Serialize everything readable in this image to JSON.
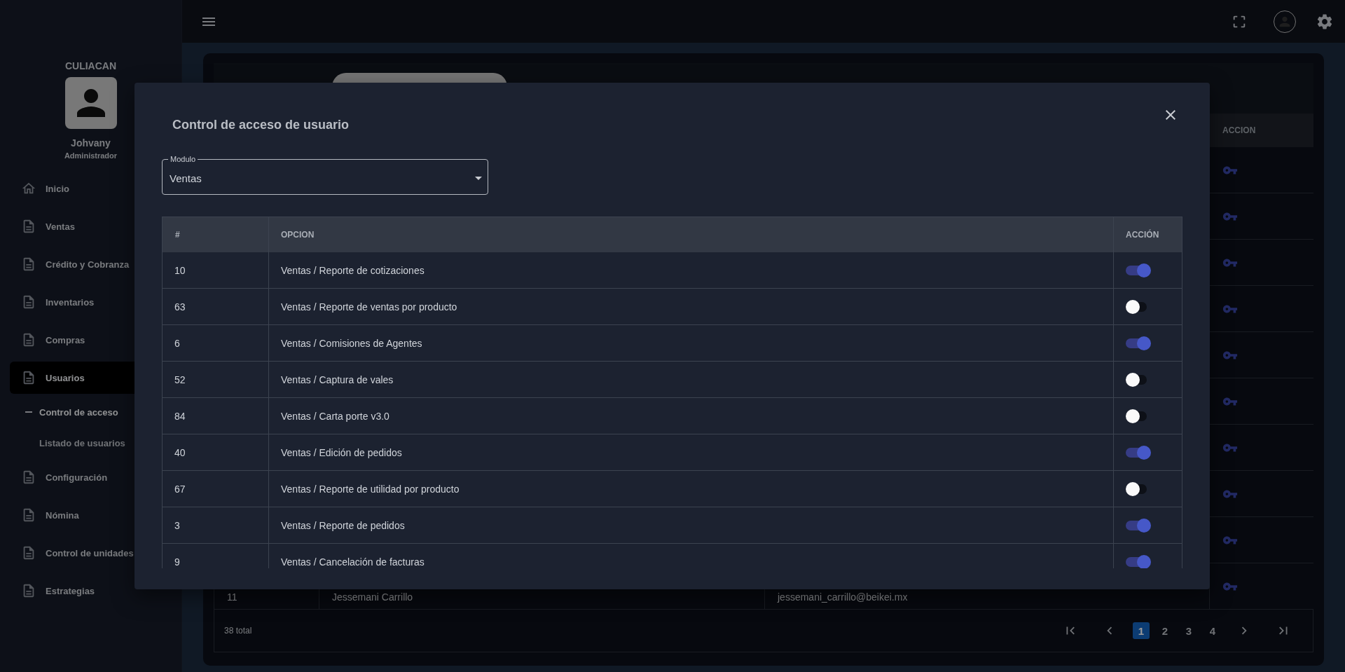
{
  "sidebar": {
    "branch": "CULIACAN",
    "user": {
      "name": "Johvany",
      "role": "Administrador"
    },
    "items": [
      {
        "label": "Inicio",
        "kind": "home",
        "selected": false
      },
      {
        "label": "Ventas",
        "kind": "document",
        "selected": false
      },
      {
        "label": "Crédito y Cobranza",
        "kind": "document",
        "selected": false
      },
      {
        "label": "Inventarios",
        "kind": "document",
        "selected": false
      },
      {
        "label": "Compras",
        "kind": "document",
        "selected": false
      },
      {
        "label": "Usuarios",
        "kind": "document",
        "selected": true,
        "children": [
          {
            "label": "Control de acceso",
            "selected": true
          },
          {
            "label": "Listado de usuarios",
            "selected": false
          }
        ]
      },
      {
        "label": "Configuración",
        "kind": "document",
        "selected": false
      },
      {
        "label": "Nómina",
        "kind": "document",
        "selected": false
      },
      {
        "label": "Control de unidades",
        "kind": "document",
        "selected": false
      },
      {
        "label": "Estrategias",
        "kind": "document",
        "selected": false
      }
    ]
  },
  "users_table": {
    "columns": [
      "ACCION"
    ],
    "rows": [
      {
        "kind": "covered"
      },
      {
        "kind": "covered"
      },
      {
        "kind": "covered"
      },
      {
        "kind": "covered"
      },
      {
        "kind": "covered"
      },
      {
        "kind": "covered"
      },
      {
        "kind": "covered"
      },
      {
        "kind": "covered"
      },
      {
        "kind": "covered"
      },
      {
        "kind": "full",
        "column_1": "11",
        "column_2": "Jessemani Carrillo",
        "column_3": "jessemani_carrillo@beikei.mx"
      }
    ],
    "total": "38 total",
    "pages": [
      {
        "label": "1",
        "selected": true
      },
      {
        "label": "2",
        "selected": false
      },
      {
        "label": "3",
        "selected": false
      },
      {
        "label": "4",
        "selected": false
      }
    ]
  },
  "dialog": {
    "title": "Control de acceso de usuario",
    "module": {
      "label": "Modulo",
      "value": "Ventas"
    },
    "columns": [
      "#",
      "OPCION",
      "ACCIÓN"
    ],
    "rows": [
      {
        "id": "10",
        "option": "Ventas / Reporte de cotizaciones",
        "on": true
      },
      {
        "id": "63",
        "option": "Ventas / Reporte de ventas por producto",
        "on": false
      },
      {
        "id": "6",
        "option": "Ventas / Comisiones de Agentes",
        "on": true
      },
      {
        "id": "52",
        "option": "Ventas / Captura de vales",
        "on": false
      },
      {
        "id": "84",
        "option": "Ventas / Carta porte v3.0",
        "on": false
      },
      {
        "id": "40",
        "option": "Ventas / Edición de pedidos",
        "on": true
      },
      {
        "id": "67",
        "option": "Ventas / Reporte de utilidad por producto",
        "on": false
      },
      {
        "id": "3",
        "option": "Ventas / Reporte de pedidos",
        "on": true
      },
      {
        "id": "9",
        "option": "Ventas / Cancelación de facturas",
        "on": true
      }
    ]
  }
}
